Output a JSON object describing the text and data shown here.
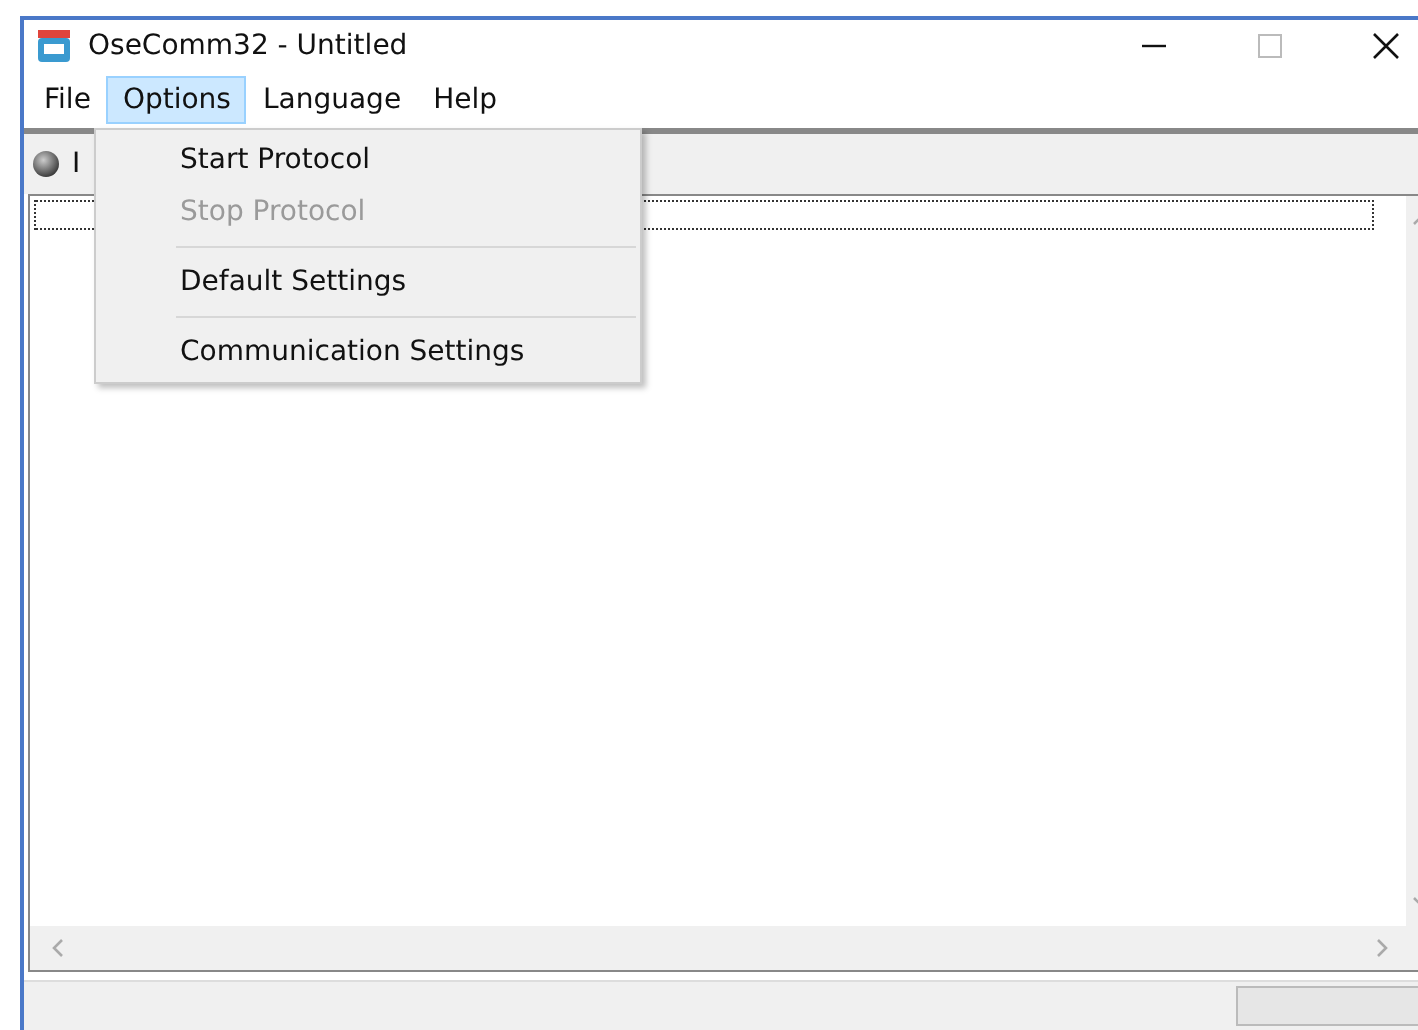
{
  "window": {
    "title": "OseComm32 - Untitled"
  },
  "menu_bar": [
    {
      "label": "File",
      "selected": false
    },
    {
      "label": "Options",
      "selected": true
    },
    {
      "label": "Language",
      "selected": false
    },
    {
      "label": "Help",
      "selected": false
    }
  ],
  "options_menu": [
    {
      "kind": "item",
      "label": "Start Protocol",
      "disabled": false
    },
    {
      "kind": "item",
      "label": "Stop Protocol",
      "disabled": true
    },
    {
      "kind": "separator"
    },
    {
      "kind": "item",
      "label": "Default Settings",
      "disabled": false
    },
    {
      "kind": "separator"
    },
    {
      "kind": "item",
      "label": "Communication Settings",
      "disabled": false
    }
  ],
  "toolbar": {
    "status_label": "I"
  }
}
